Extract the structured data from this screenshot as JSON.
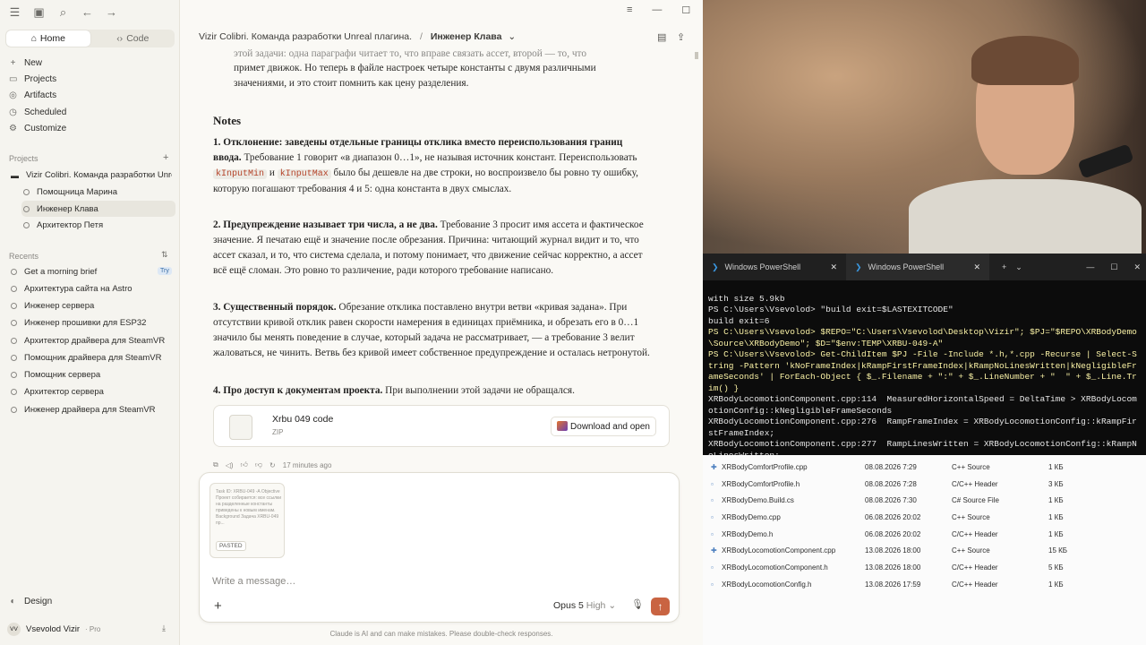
{
  "sidebar": {
    "home_label": "Home",
    "code_label": "Code",
    "nav": [
      {
        "label": "New",
        "icon": "plus-icon"
      },
      {
        "label": "Projects",
        "icon": "folder-icon"
      },
      {
        "label": "Artifacts",
        "icon": "artifact-icon"
      },
      {
        "label": "Scheduled",
        "icon": "clock-icon"
      },
      {
        "label": "Customize",
        "icon": "customize-icon"
      }
    ],
    "projects_heading": "Projects",
    "project_name": "Vizir Colibri. Команда разработки Unre",
    "project_items": [
      "Помощница Марина",
      "Инженер Клава",
      "Архитектор Петя"
    ],
    "recents_heading": "Recents",
    "try_badge": "Try",
    "recents": [
      "Get a morning brief",
      "Архитектура сайта на Astro",
      "Инженер сервера",
      "Инженер прошивки для ESP32",
      "Архитектор драйвера для SteamVR",
      "Помощник драйвера для SteamVR",
      "Помощник сервера",
      "Архитектор сервера",
      "Инженер драйвера для SteamVR"
    ],
    "design_label": "Design",
    "user_initials": "VV",
    "user_name": "Vsevolod Vizir",
    "user_plan": "· Pro"
  },
  "header": {
    "project": "Vizir Colibri. Команда разработки Unreal плагина.",
    "separator": "/",
    "chat": "Инженер Клава"
  },
  "content": {
    "top_clipped": "этой задачи: одна параграфи читает то, что вправе связать ассет, второй — то, что",
    "top_line2": "примет движок. Но теперь в файле настроек четыре константы с двумя различными",
    "top_line3": "значениями, и это стоит помнить как цену разделения.",
    "notes_heading": "Notes",
    "n1_bold": "1. Отклонение: заведены отдельные границы отклика вместо переиспользования границ ввода.",
    "n1_a": " Требование 1 говорит «в диапазон 0…1», не называя источник констант. Переиспользовать ",
    "n1_code1": "kInputMin",
    "n1_and": " и ",
    "n1_code2": "kInputMax",
    "n1_b": " было бы дешевле на две строки, но воспроизвело бы ровно ту ошибку, которую погашают требования 4 и 5: одна константа в двух смыслах.",
    "n2_bold": "2. Предупреждение называет три числа, а не два.",
    "n2_text": " Требование 3 просит имя ассета и фактическое значение. Я печатаю ещё и значение после обрезания. Причина: читающий журнал видит и то, что ассет сказал, и то, что система сделала, и потому понимает, что движение сейчас корректно, а ассет всё ещё сломан. Это ровно то различение, ради которого требование написано.",
    "n3_bold": "3. Существенный порядок.",
    "n3_text": " Обрезание отклика поставлено внутри ветви «кривая задана». При отсутствии кривой отклик равен скорости намерения в единицах приёмника, и обрезать его в 0…1 значило бы менять поведение в случае, который задача не рассматривает, — а требование 3 велит жаловаться, не чинить. Ветвь без кривой имеет собственное предупреждение и осталась нетронутой.",
    "n4_bold": "4. Про доступ к документам проекта.",
    "n4_text": " При выполнении этой задачи не обращался.",
    "file_name": "Xrbu 049 code",
    "file_type": "ZIP",
    "download_label": "Download and open",
    "timestamp": "17 minutes ago"
  },
  "composer": {
    "pasted_preview": "Task ID: XRBU-049 -A Objective Проект собирается: все ссылки на разделенные константы приведены к новым именам. Background Задача XRBU-049 пр...",
    "pasted_badge": "PASTED",
    "placeholder": "Write a message…",
    "model": "Opus 5",
    "effort": "High"
  },
  "disclaimer": "Claude is AI and can make mistakes. Please double-check responses.",
  "terminal": {
    "tab1": "Windows PowerShell",
    "tab2": "Windows PowerShell",
    "lines": [
      "with size 5.9kb",
      "PS C:\\Users\\Vsevolod> \"build exit=$LASTEXITCODE\"",
      "build exit=6",
      "PS C:\\Users\\Vsevolod> $REPO=\"C:\\Users\\Vsevolod\\Desktop\\Vizir\"; $PJ=\"$REPO\\XRBodyDemo\\Source\\XRBodyDemo\"; $D=\"$env:TEMP\\XRBU-049-A\"",
      "PS C:\\Users\\Vsevolod> Get-ChildItem $PJ -File -Include *.h,*.cpp -Recurse | Select-String -Pattern 'kNoFrameIndex|kRampFirstFrameIndex|kRampNoLinesWritten|kNegligibleFrameSeconds' | ForEach-Object { $_.Filename + \":\" + $_.LineNumber + \"  \" + $_.Line.Trim() }",
      "XRBodyLocomotionComponent.cpp:114  MeasuredHorizontalSpeed = DeltaTime > XRBodyLocomotionConfig::kNegligibleFrameSeconds",
      "XRBodyLocomotionComponent.cpp:276  RampFrameIndex = XRBodyLocomotionConfig::kRampFirstFrameIndex;",
      "XRBodyLocomotionComponent.cpp:277  RampLinesWritten = XRBodyLocomotionConfig::kRampNoLinesWritten;"
    ]
  },
  "files": [
    {
      "name": "XRBodyComfortProfile.cpp",
      "date": "08.08.2026 7:29",
      "type": "C++ Source",
      "size": "1 КБ"
    },
    {
      "name": "XRBodyComfortProfile.h",
      "date": "08.08.2026 7:28",
      "type": "C/C++ Header",
      "size": "3 КБ"
    },
    {
      "name": "XRBodyDemo.Build.cs",
      "date": "08.08.2026 7:30",
      "type": "C# Source File",
      "size": "1 КБ"
    },
    {
      "name": "XRBodyDemo.cpp",
      "date": "06.08.2026 20:02",
      "type": "C++ Source",
      "size": "1 КБ"
    },
    {
      "name": "XRBodyDemo.h",
      "date": "06.08.2026 20:02",
      "type": "C/C++ Header",
      "size": "1 КБ"
    },
    {
      "name": "XRBodyLocomotionComponent.cpp",
      "date": "13.08.2026 18:00",
      "type": "C++ Source",
      "size": "15 КБ"
    },
    {
      "name": "XRBodyLocomotionComponent.h",
      "date": "13.08.2026 18:00",
      "type": "C/C++ Header",
      "size": "5 КБ"
    },
    {
      "name": "XRBodyLocomotionConfig.h",
      "date": "13.08.2026 17:59",
      "type": "C/C++ Header",
      "size": "1 КБ"
    }
  ],
  "colors": {
    "accent": "#c96442",
    "terminal_bg": "#0c0c0c",
    "prompt_yellow": "#f9f1a5"
  }
}
